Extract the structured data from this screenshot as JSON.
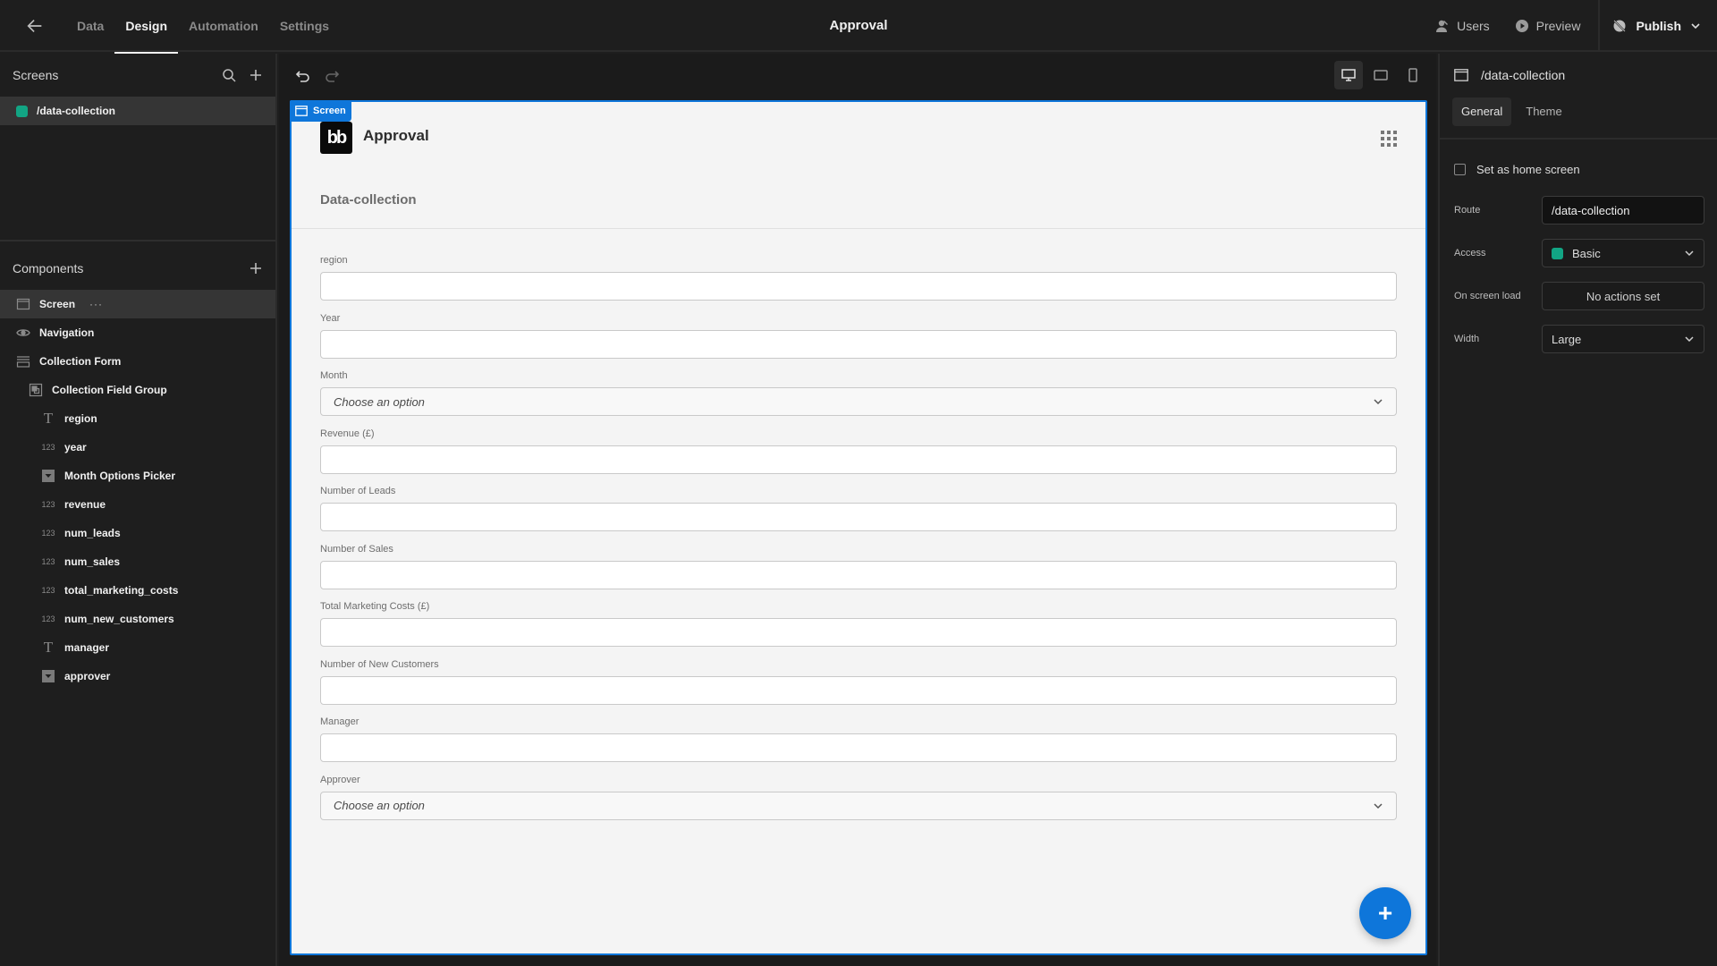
{
  "topbar": {
    "back_icon": "arrow-left-icon",
    "tabs": [
      {
        "label": "Data",
        "active": false
      },
      {
        "label": "Design",
        "active": true
      },
      {
        "label": "Automation",
        "active": false
      },
      {
        "label": "Settings",
        "active": false
      }
    ],
    "app_title": "Approval",
    "users_label": "Users",
    "preview_label": "Preview",
    "publish_label": "Publish"
  },
  "screens_panel": {
    "title": "Screens",
    "screens": [
      {
        "route": "/data-collection",
        "color": "#12a584",
        "selected": true
      }
    ]
  },
  "components_panel": {
    "title": "Components",
    "items": [
      {
        "label": "Screen",
        "icon": "screen-icon",
        "level": 0,
        "selected": true
      },
      {
        "label": "Navigation",
        "icon": "eye-icon",
        "level": 0
      },
      {
        "label": "Collection Form",
        "icon": "form-icon",
        "level": 0
      },
      {
        "label": "Collection Field Group",
        "icon": "field-group-icon",
        "level": 1
      },
      {
        "label": "region",
        "icon": "text-icon",
        "level": 2
      },
      {
        "label": "year",
        "icon": "number-icon",
        "level": 2
      },
      {
        "label": "Month Options Picker",
        "icon": "dropdown-icon",
        "level": 2
      },
      {
        "label": "revenue",
        "icon": "number-icon",
        "level": 2
      },
      {
        "label": "num_leads",
        "icon": "number-icon",
        "level": 2
      },
      {
        "label": "num_sales",
        "icon": "number-icon",
        "level": 2
      },
      {
        "label": "total_marketing_costs",
        "icon": "number-icon",
        "level": 2
      },
      {
        "label": "num_new_customers",
        "icon": "number-icon",
        "level": 2
      },
      {
        "label": "manager",
        "icon": "text-icon",
        "level": 2
      },
      {
        "label": "approver",
        "icon": "dropdown-icon",
        "level": 2
      }
    ],
    "number_glyph": "123",
    "text_glyph": "T",
    "more_glyph": "···"
  },
  "canvas": {
    "screen_tag": "Screen",
    "logo_text": "bb",
    "brand_title": "Approval",
    "page_heading": "Data-collection",
    "fields": [
      {
        "label": "region",
        "type": "text",
        "value": ""
      },
      {
        "label": "Year",
        "type": "text",
        "value": ""
      },
      {
        "label": "Month",
        "type": "select",
        "placeholder": "Choose an option"
      },
      {
        "label": "Revenue (£)",
        "type": "text",
        "value": ""
      },
      {
        "label": "Number of Leads",
        "type": "text",
        "value": ""
      },
      {
        "label": "Number of Sales",
        "type": "text",
        "value": ""
      },
      {
        "label": "Total Marketing Costs (£)",
        "type": "text",
        "value": ""
      },
      {
        "label": "Number of New Customers",
        "type": "text",
        "value": ""
      },
      {
        "label": "Manager",
        "type": "text",
        "value": ""
      },
      {
        "label": "Approver",
        "type": "select",
        "placeholder": "Choose an option"
      }
    ],
    "fab_glyph": "+"
  },
  "settings_panel": {
    "title": "/data-collection",
    "tabs": [
      {
        "label": "General",
        "active": true
      },
      {
        "label": "Theme",
        "active": false
      }
    ],
    "home_checkbox_label": "Set as home screen",
    "home_checked": false,
    "route_label": "Route",
    "route_value": "/data-collection",
    "access_label": "Access",
    "access_value": "Basic",
    "access_color": "#12a584",
    "onload_label": "On screen load",
    "onload_value": "No actions set",
    "width_label": "Width",
    "width_value": "Large"
  },
  "colors": {
    "accent": "#0e76da",
    "access_green": "#12a584"
  }
}
